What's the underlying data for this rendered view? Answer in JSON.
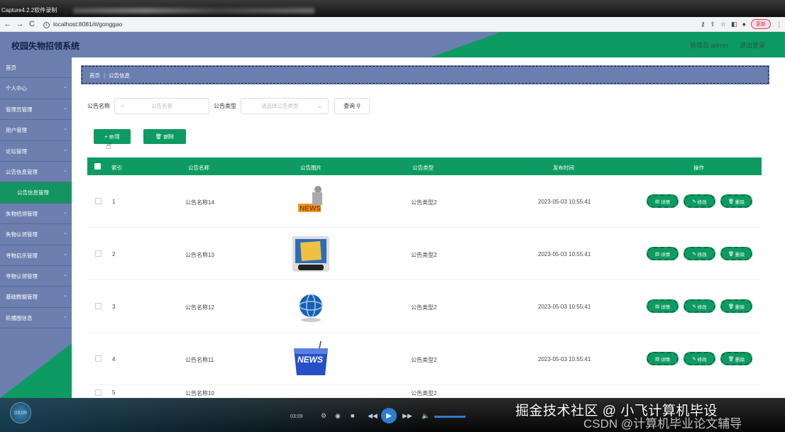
{
  "recorder": {
    "title": "Capture4.2.2软件录制"
  },
  "browser": {
    "url": "localhost:8081/#/gonggao",
    "update_label": "更新"
  },
  "header": {
    "app_title": "校园失物招领系统",
    "user": "管理员 admin",
    "logout": "退出登录"
  },
  "sidebar": {
    "items": [
      {
        "label": "首页",
        "has_chevron": false
      },
      {
        "label": "个人中心",
        "has_chevron": true
      },
      {
        "label": "管理员管理",
        "has_chevron": true
      },
      {
        "label": "用户管理",
        "has_chevron": true
      },
      {
        "label": "论坛管理",
        "has_chevron": true
      },
      {
        "label": "公告信息管理",
        "has_chevron": true
      },
      {
        "label": "公告信息管理",
        "sub": true
      },
      {
        "label": "失物招领管理",
        "has_chevron": true
      },
      {
        "label": "失物认领管理",
        "has_chevron": true
      },
      {
        "label": "寻物启示管理",
        "has_chevron": true
      },
      {
        "label": "寻物认领管理",
        "has_chevron": true
      },
      {
        "label": "基础数据管理",
        "has_chevron": true
      },
      {
        "label": "轮播图信息",
        "has_chevron": true
      }
    ]
  },
  "breadcrumb": {
    "home": "首页",
    "current": "公告信息"
  },
  "search": {
    "name_label": "公告名称",
    "name_placeholder": "公告名称",
    "type_label": "公告类型",
    "type_placeholder": "请选择公告类型",
    "query_label": "查询"
  },
  "actions": {
    "add_label": "+ 新增",
    "delete_label": "删除"
  },
  "table": {
    "headers": [
      "索引",
      "公告名称",
      "公告图片",
      "公告类型",
      "发布时间",
      "操作"
    ],
    "rows": [
      {
        "index": "1",
        "name": "公告名称14",
        "image": "news-figure",
        "type": "公告类型2",
        "time": "2023-05-03 10:55:41"
      },
      {
        "index": "2",
        "name": "公告名称13",
        "image": "hot-news-tablet",
        "type": "公告类型2",
        "time": "2023-05-03 10:55:41"
      },
      {
        "index": "3",
        "name": "公告名称12",
        "image": "globe-news",
        "type": "公告类型2",
        "time": "2023-05-03 10:55:41"
      },
      {
        "index": "4",
        "name": "公告名称11",
        "image": "news-key",
        "type": "公告类型2",
        "time": "2023-05-03 10:55:41"
      }
    ],
    "partial_row": {
      "index": "5",
      "name": "公告名称10",
      "type": "公告类型2"
    },
    "ops": {
      "detail": "详情",
      "edit": "修改",
      "delete": "删除"
    }
  },
  "player": {
    "time_circle": "03:09",
    "time": "03:09"
  },
  "watermark": {
    "line1": "掘金技术社区 @ 小飞计算机毕设",
    "line2": "CSDN @计算机毕业论文辅导"
  },
  "colors": {
    "primary_green": "#0e9b62",
    "nav_blue": "#6a7fb0"
  }
}
